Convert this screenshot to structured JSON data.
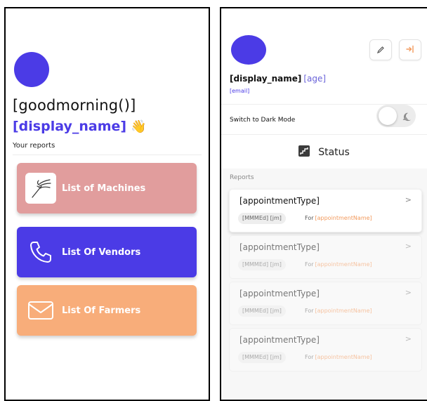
{
  "left_screen": {
    "greeting": "[goodmorning()]",
    "display_name": "[display_name]",
    "wave_emoji": "👋",
    "section_label": "Your reports",
    "cards": [
      {
        "label": "List of Machines",
        "icon": "rake-icon",
        "color": "#E19D9D"
      },
      {
        "label": "List Of Vendors",
        "icon": "phone-icon",
        "color": "#4B3BE6"
      },
      {
        "label": "List Of Farmers",
        "icon": "mail-icon",
        "color": "#F8AD7A"
      }
    ]
  },
  "right_screen": {
    "profile": {
      "name": "[display_name]",
      "age": "[age]",
      "email": "[email]"
    },
    "actions": {
      "edit_icon": "pencil-icon",
      "logout_icon": "logout-icon"
    },
    "dark_mode_label": "Switch to Dark Mode",
    "dark_mode_on": false,
    "status_label": "Status",
    "reports_heading": "Reports",
    "appointments": [
      {
        "type": "[appointmentType]",
        "date": "[MMMEd] [jm]",
        "for_label": "For",
        "name": "[appointmentName]",
        "state": "active"
      },
      {
        "type": "[appointmentType]",
        "date": "[MMMEd] [jm]",
        "for_label": "For",
        "name": "[appointmentName]",
        "state": "inactive"
      },
      {
        "type": "[appointmentType]",
        "date": "[MMMEd] [jm]",
        "for_label": "For",
        "name": "[appointmentName]",
        "state": "inactive"
      },
      {
        "type": "[appointmentType]",
        "date": "[MMMEd] [jm]",
        "for_label": "For",
        "name": "[appointmentName]",
        "state": "inactive"
      }
    ]
  },
  "colors": {
    "primary": "#4B3BE6",
    "machines": "#E19D9D",
    "farmers": "#F8AD7A",
    "accent_orange": "#F29A5D"
  }
}
